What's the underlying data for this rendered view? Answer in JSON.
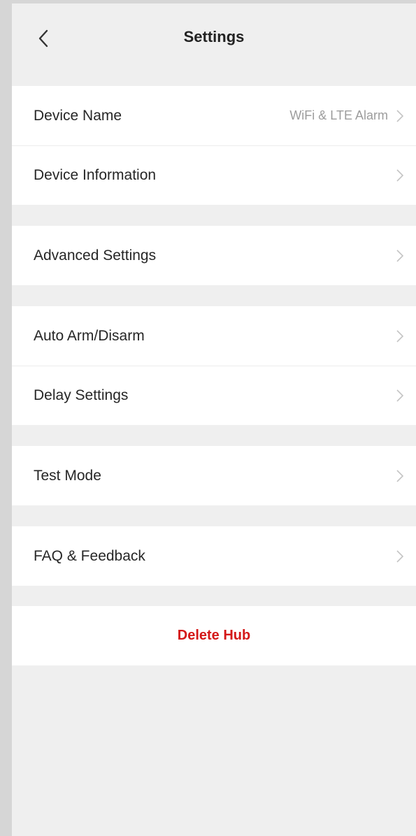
{
  "header": {
    "title": "Settings"
  },
  "groups": [
    {
      "rows": [
        {
          "label": "Device Name",
          "value": "WiFi & LTE Alarm"
        },
        {
          "label": "Device Information"
        }
      ]
    },
    {
      "rows": [
        {
          "label": "Advanced Settings"
        }
      ]
    },
    {
      "rows": [
        {
          "label": "Auto Arm/Disarm"
        },
        {
          "label": "Delay Settings"
        }
      ]
    },
    {
      "rows": [
        {
          "label": "Test Mode"
        }
      ]
    },
    {
      "rows": [
        {
          "label": "FAQ & Feedback"
        }
      ]
    }
  ],
  "delete_label": "Delete Hub",
  "colors": {
    "background": "#efefef",
    "danger": "#d41818",
    "chevron": "#c4c4c4"
  },
  "icons": {
    "back": "chevron-left-icon",
    "row": "chevron-right-icon"
  }
}
